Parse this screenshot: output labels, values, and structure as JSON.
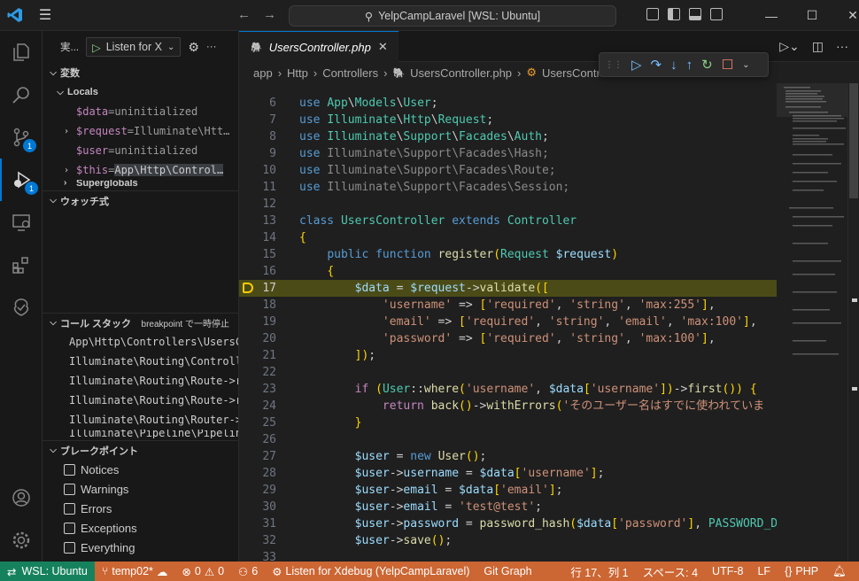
{
  "title": {
    "search_text": "YelpCampLaravel [WSL: Ubuntu]"
  },
  "activity": {
    "scm_badge": "1",
    "debug_badge": "1"
  },
  "sidebar": {
    "run_label": "実...",
    "config": "Listen for X",
    "variables_header": "変数",
    "locals_header": "Locals",
    "variables": [
      {
        "name": "$data",
        "value": "uninitialized",
        "expandable": false
      },
      {
        "name": "$request",
        "value": "Illuminate\\Htt…",
        "expandable": true
      },
      {
        "name": "$user",
        "value": "uninitialized",
        "expandable": false
      },
      {
        "name": "$this",
        "value": "App\\Http\\Control…",
        "expandable": true
      }
    ],
    "superglobals": "Superglobals",
    "watch_header": "ウォッチ式",
    "callstack_header": "コール スタック",
    "callstack_status": "breakpoint で一時停止",
    "callstack": [
      "App\\Http\\Controllers\\UsersC",
      "Illuminate\\Routing\\Controll",
      "Illuminate\\Routing\\Route->r",
      "Illuminate\\Routing\\Route->r",
      "Illuminate\\Routing\\Router->",
      "Illuminate\\Pipeline\\Pipelin"
    ],
    "breakpoints_header": "ブレークポイント",
    "breakpoints": [
      "Notices",
      "Warnings",
      "Errors",
      "Exceptions",
      "Everything"
    ]
  },
  "editor": {
    "tab": "UsersController.php",
    "breadcrumb": [
      "app",
      "Http",
      "Controllers",
      "UsersController.php",
      "UsersContr"
    ],
    "current_line": "17"
  },
  "code_lines": [
    {
      "n": "6",
      "t": "use App\\Models\\User;"
    },
    {
      "n": "7",
      "t": "use Illuminate\\Http\\Request;"
    },
    {
      "n": "8",
      "t": "use Illuminate\\Support\\Facades\\Auth;"
    },
    {
      "n": "9",
      "t": "use Illuminate\\Support\\Facades\\Hash;"
    },
    {
      "n": "10",
      "t": "use Illuminate\\Support\\Facades\\Route;"
    },
    {
      "n": "11",
      "t": "use Illuminate\\Support\\Facades\\Session;"
    },
    {
      "n": "12",
      "t": ""
    },
    {
      "n": "13",
      "t": "class UsersController extends Controller"
    },
    {
      "n": "14",
      "t": "{"
    },
    {
      "n": "15",
      "t": "    public function register(Request $request)"
    },
    {
      "n": "16",
      "t": "    {"
    },
    {
      "n": "17",
      "t": "        $data = $request->validate(["
    },
    {
      "n": "18",
      "t": "            'username' => ['required', 'string', 'max:255'],"
    },
    {
      "n": "19",
      "t": "            'email' => ['required', 'string', 'email', 'max:100'],"
    },
    {
      "n": "20",
      "t": "            'password' => ['required', 'string', 'max:100'],"
    },
    {
      "n": "21",
      "t": "        ]);"
    },
    {
      "n": "22",
      "t": ""
    },
    {
      "n": "23",
      "t": "        if (User::where('username', $data['username'])->first()) {"
    },
    {
      "n": "24",
      "t": "            return back()->withErrors('そのユーザー名はすでに使われていま"
    },
    {
      "n": "25",
      "t": "        }"
    },
    {
      "n": "26",
      "t": ""
    },
    {
      "n": "27",
      "t": "        $user = new User();"
    },
    {
      "n": "28",
      "t": "        $user->username = $data['username'];"
    },
    {
      "n": "29",
      "t": "        $user->email = $data['email'];"
    },
    {
      "n": "30",
      "t": "        $user->email = 'test@test';"
    },
    {
      "n": "31",
      "t": "        $user->password = password_hash($data['password'], PASSWORD_DE"
    },
    {
      "n": "32",
      "t": "        $user->save();"
    },
    {
      "n": "33",
      "t": ""
    }
  ],
  "status": {
    "remote": "WSL: Ubuntu",
    "branch": "temp02*",
    "errors": "0",
    "warnings": "0",
    "ports": "6",
    "debug": "Listen for Xdebug (YelpCampLaravel)",
    "gitgraph": "Git Graph",
    "position": "行 17、列 1",
    "spaces": "スペース: 4",
    "encoding": "UTF-8",
    "eol": "LF",
    "language": "PHP"
  },
  "colors": {
    "status_bg": "#cc6633",
    "remote_bg": "#16825d",
    "accent": "#0078d4",
    "current_line": "#4b4b18"
  }
}
